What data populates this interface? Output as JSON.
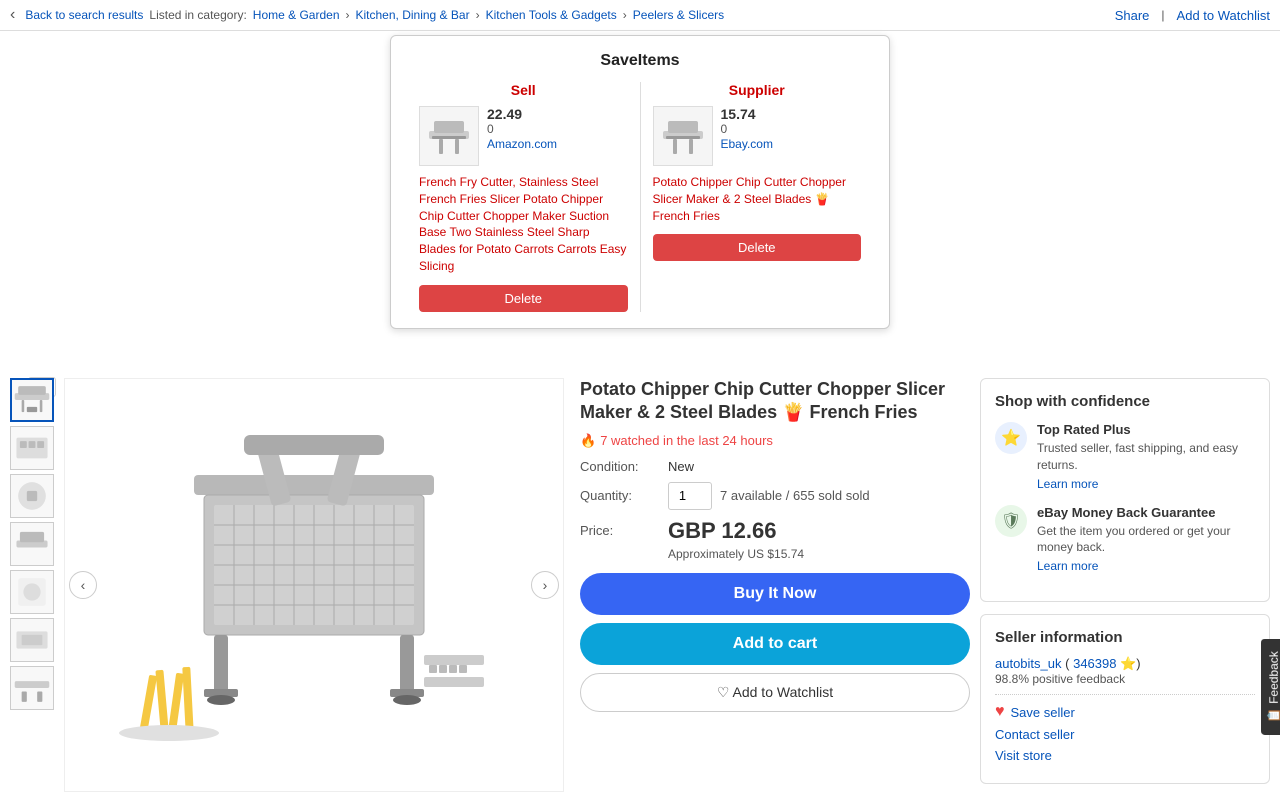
{
  "nav": {
    "back_label": "Back to search results",
    "category_prefix": "Listed in category:",
    "breadcrumbs": [
      {
        "label": "Home & Garden",
        "url": "#"
      },
      {
        "label": "Kitchen, Dining & Bar",
        "url": "#"
      },
      {
        "label": "Kitchen Tools & Gadgets",
        "url": "#"
      },
      {
        "label": "Peelers & Slicers",
        "url": "#"
      }
    ],
    "share_label": "Share",
    "watchlist_label": "Add to Watchlist"
  },
  "save_items": {
    "title": "SaveItems",
    "sell_header": "Sell",
    "supplier_header": "Supplier",
    "sell_item": {
      "price": "22.49",
      "sold": "0",
      "store": "Amazon.com",
      "title": "French Fry Cutter, Stainless Steel French Fries Slicer Potato Chipper Chip Cutter Chopper Maker Suction Base Two Stainless Steel Sharp Blades for Potato Carrots Carrots Easy Slicing",
      "delete_label": "Delete"
    },
    "supplier_item": {
      "price": "15.74",
      "sold": "0",
      "store": "Ebay.com",
      "title": "Potato Chipper Chip Cutter Chopper Slicer Maker & 2 Steel Blades 🍟 French Fries",
      "delete_label": "Delete"
    }
  },
  "product": {
    "title": "Potato Chipper Chip Cutter Chopper Slicer Maker & 2 Steel Blades 🍟 French Fries",
    "watched_text": "7 watched in the last 24 hours",
    "condition_label": "Condition:",
    "condition_value": "New",
    "quantity_label": "Quantity:",
    "quantity_value": "1",
    "quantity_available": "7 available",
    "quantity_sold": "655 sold",
    "price_label": "Price:",
    "price_main": "GBP 12.66",
    "price_approx": "Approximately US $15.74",
    "buy_now_label": "Buy It Now",
    "add_cart_label": "Add to cart",
    "watchlist_label": "♡ Add to Watchlist"
  },
  "confidence": {
    "title": "Shop with confidence",
    "items": [
      {
        "icon": "⭐",
        "icon_type": "blue",
        "heading": "Top Rated Plus",
        "text": "Trusted seller, fast shipping, and easy returns.",
        "learn_more": "Learn more"
      },
      {
        "icon": "🛡",
        "icon_type": "green",
        "heading": "eBay Money Back Guarantee",
        "text": "Get the item you ordered or get your money back.",
        "learn_more": "Learn more"
      }
    ]
  },
  "seller": {
    "title": "Seller information",
    "name": "autobits_uk",
    "rating_id": "346398",
    "rating_star": "⭐",
    "feedback_text": "98.8% positive feedback",
    "save_label": "Save seller",
    "contact_label": "Contact seller",
    "visit_label": "Visit store"
  },
  "feedback_tab": {
    "label": "Feedback",
    "icon": "📋"
  }
}
